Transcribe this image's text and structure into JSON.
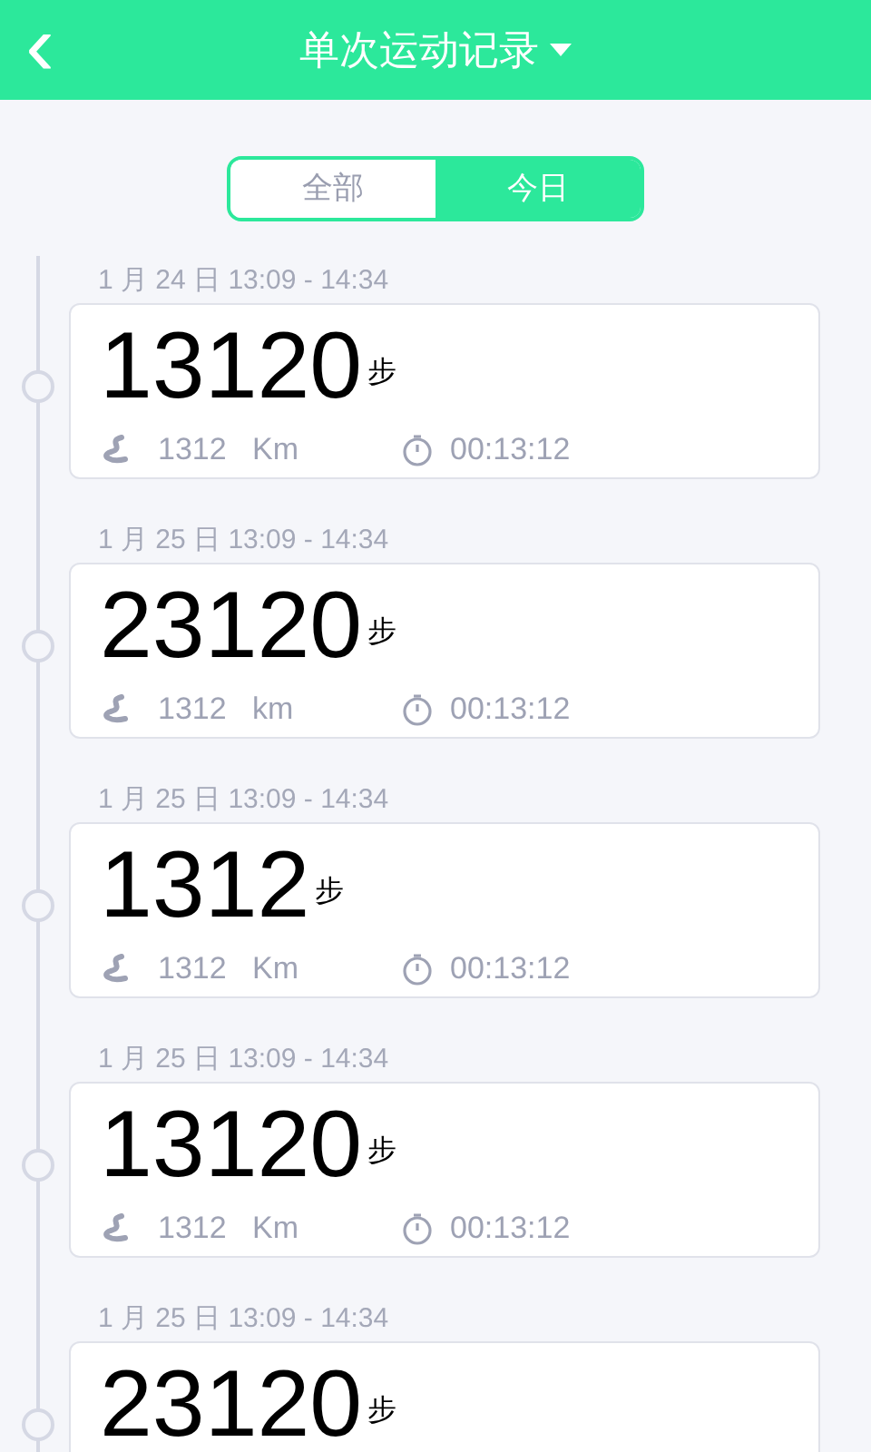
{
  "header": {
    "title": "单次运动记录",
    "back": "‹"
  },
  "tabs": [
    {
      "label": "全部",
      "selected": false
    },
    {
      "label": "今日",
      "selected": true
    }
  ],
  "records": [
    {
      "date": "1 月 24 日 13:09 - 14:34",
      "steps": "13120",
      "unit": "步",
      "distance": "1312",
      "distance_unit": "Km",
      "duration": "00:13:12"
    },
    {
      "date": "1 月 25 日 13:09 - 14:34",
      "steps": "23120",
      "unit": "步",
      "distance": "1312",
      "distance_unit": "km",
      "duration": "00:13:12"
    },
    {
      "date": "1 月 25 日 13:09 - 14:34",
      "steps": "1312",
      "unit": "步",
      "distance": "1312",
      "distance_unit": "Km",
      "duration": "00:13:12"
    },
    {
      "date": "1 月 25 日 13:09 - 14:34",
      "steps": "13120",
      "unit": "步",
      "distance": "1312",
      "distance_unit": "Km",
      "duration": "00:13:12"
    },
    {
      "date": "1 月 25 日 13:09 - 14:34",
      "steps": "23120",
      "unit": "步"
    }
  ]
}
